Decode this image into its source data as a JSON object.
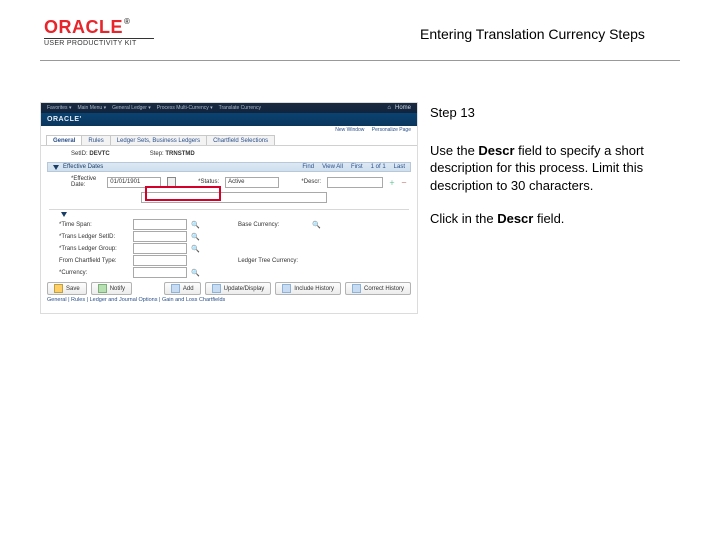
{
  "header": {
    "logo_text": "ORACLE",
    "logo_subtext": "USER PRODUCTIVITY KIT",
    "title": "Entering Translation Currency Steps"
  },
  "instructions": {
    "step_label": "Step 13",
    "para1_pre": "Use the ",
    "para1_b1": "Descr",
    "para1_post": " field to specify a short description for this process. Limit this description to 30 characters.",
    "para2_pre": "Click in the ",
    "para2_b1": "Descr",
    "para2_post": " field."
  },
  "screenshot": {
    "os_bar": {
      "items": [
        "Favorites ▾",
        "Main Menu ▾",
        "General Ledger ▾",
        "Process Multi-Currency ▾",
        "Translate Currency"
      ],
      "home_link": "Home"
    },
    "brand": "ORACLE'",
    "util_links": {
      "a": "New Window",
      "b": "Personalize Page"
    },
    "tabs": {
      "t1": "General",
      "t2": "Rules",
      "t3": "Ledger Sets, Business Ledgers",
      "t4": "Chartfield Selections"
    },
    "id_line": {
      "setid_lab": "SetID:",
      "setid_val": "DEVTC",
      "step_lab": "Step:",
      "step_val": "TRNSTMD"
    },
    "section": {
      "title": "Effective Dates",
      "tool_find": "Find",
      "tool_view": "View All",
      "tool_first": "First",
      "tool_count": "1 of 1",
      "tool_last": "Last"
    },
    "form": {
      "effdate_lab": "*Effective Date:",
      "effdate_val": "01/01/1901",
      "status_lab": "*Status:",
      "status_val": "Active",
      "descr_lab": "*Descr:"
    },
    "lower": {
      "time_lab": "*Time Span:",
      "base_lab": "Base Currency:",
      "tset_lab": "*Trans Ledger SetID:",
      "tgroup_lab": "*Trans Ledger Group:",
      "acct_lab": "From Chartfield Type:",
      "lvl_lab": "Ledger Tree Currency:",
      "currency_lab": "*Currency:"
    },
    "buttons": {
      "save": "Save",
      "notify": "Notify",
      "add": "Add",
      "update": "Update/Display",
      "include": "Include History",
      "correct": "Correct History"
    },
    "foot": "General | Rules | Ledger and Journal Options | Gain and Loss Chartfields"
  }
}
